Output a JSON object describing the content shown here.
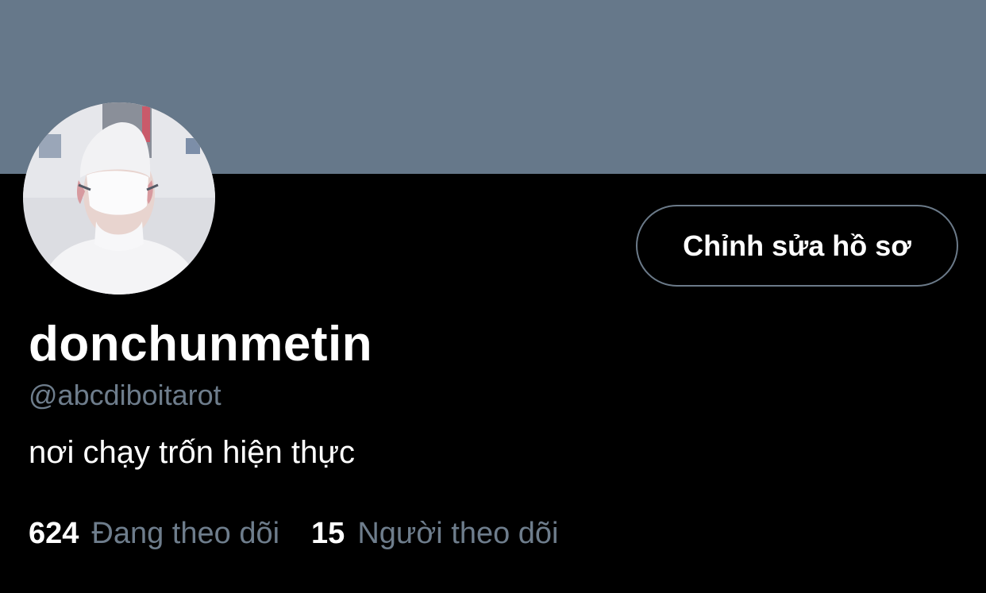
{
  "profile": {
    "display_name": "donchunmetin",
    "handle": "@abcdiboitarot",
    "bio": "nơi chạy trốn hiện thực",
    "edit_profile_label": "Chỉnh sửa hồ sơ"
  },
  "stats": {
    "following_count": "624",
    "following_label": "Đang theo dõi",
    "followers_count": "15",
    "followers_label": "Người theo dõi"
  },
  "colors": {
    "banner": "#66788a",
    "background": "#000000",
    "secondary_text": "#6e7d8c",
    "button_border": "#6b7a89"
  }
}
